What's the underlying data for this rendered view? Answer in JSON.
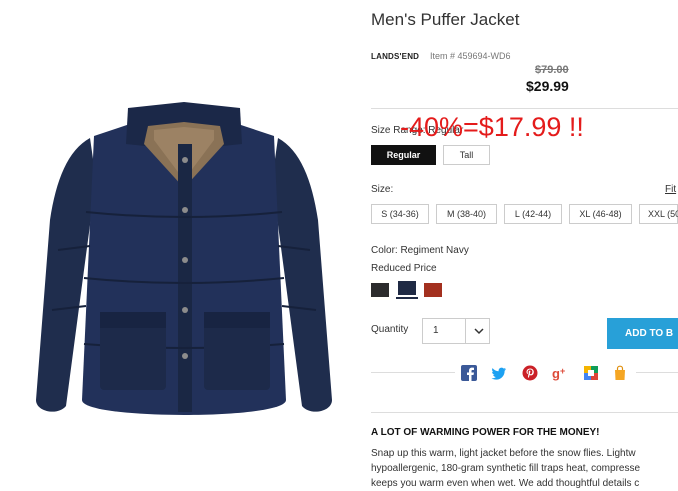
{
  "product": {
    "title": "Men's Puffer Jacket",
    "brand": "LANDS'END",
    "item_number": "Item # 459694-WD6",
    "old_price": "$79.00",
    "price": "$29.99",
    "image_icon": "navy-puffer-jacket-image"
  },
  "promo_annotation": "-40%=$17.99 !!",
  "size_range": {
    "label": "Size Range: Regular",
    "options": [
      "Regular",
      "Tall"
    ],
    "selected": "Regular"
  },
  "size": {
    "label": "Size:",
    "fit_link": "Fit",
    "options": [
      "S (34-36)",
      "M (38-40)",
      "L (42-44)",
      "XL (46-48)",
      "XXL (50"
    ]
  },
  "color": {
    "label": "Color: Regiment Navy",
    "sublabel": "Reduced Price",
    "swatches": [
      {
        "name": "black",
        "hex": "#2b2b2d"
      },
      {
        "name": "regiment-navy",
        "hex": "#1f2a44"
      },
      {
        "name": "red",
        "hex": "#a3301f"
      }
    ],
    "selected": "regiment-navy"
  },
  "quantity": {
    "label": "Quantity",
    "value": "1"
  },
  "add_to_bag": "ADD TO B",
  "share_icons": [
    "facebook-icon",
    "twitter-icon",
    "pinterest-icon",
    "google-plus-icon",
    "multicolor-share-icon",
    "shopping-bag-icon"
  ],
  "description": {
    "heading": "A LOT OF WARMING POWER FOR THE MONEY!",
    "lines": [
      "Snap up this warm, light jacket before the snow flies. Lightw",
      "hypoallergenic, 180-gram synthetic fill traps heat, compresse",
      "keeps you warm even when wet. We add thoughtful details c"
    ]
  },
  "colors": {
    "accent_blue": "#28a0d8",
    "promo_red": "#e41b1b",
    "jacket_navy": "#1e2c4c"
  }
}
